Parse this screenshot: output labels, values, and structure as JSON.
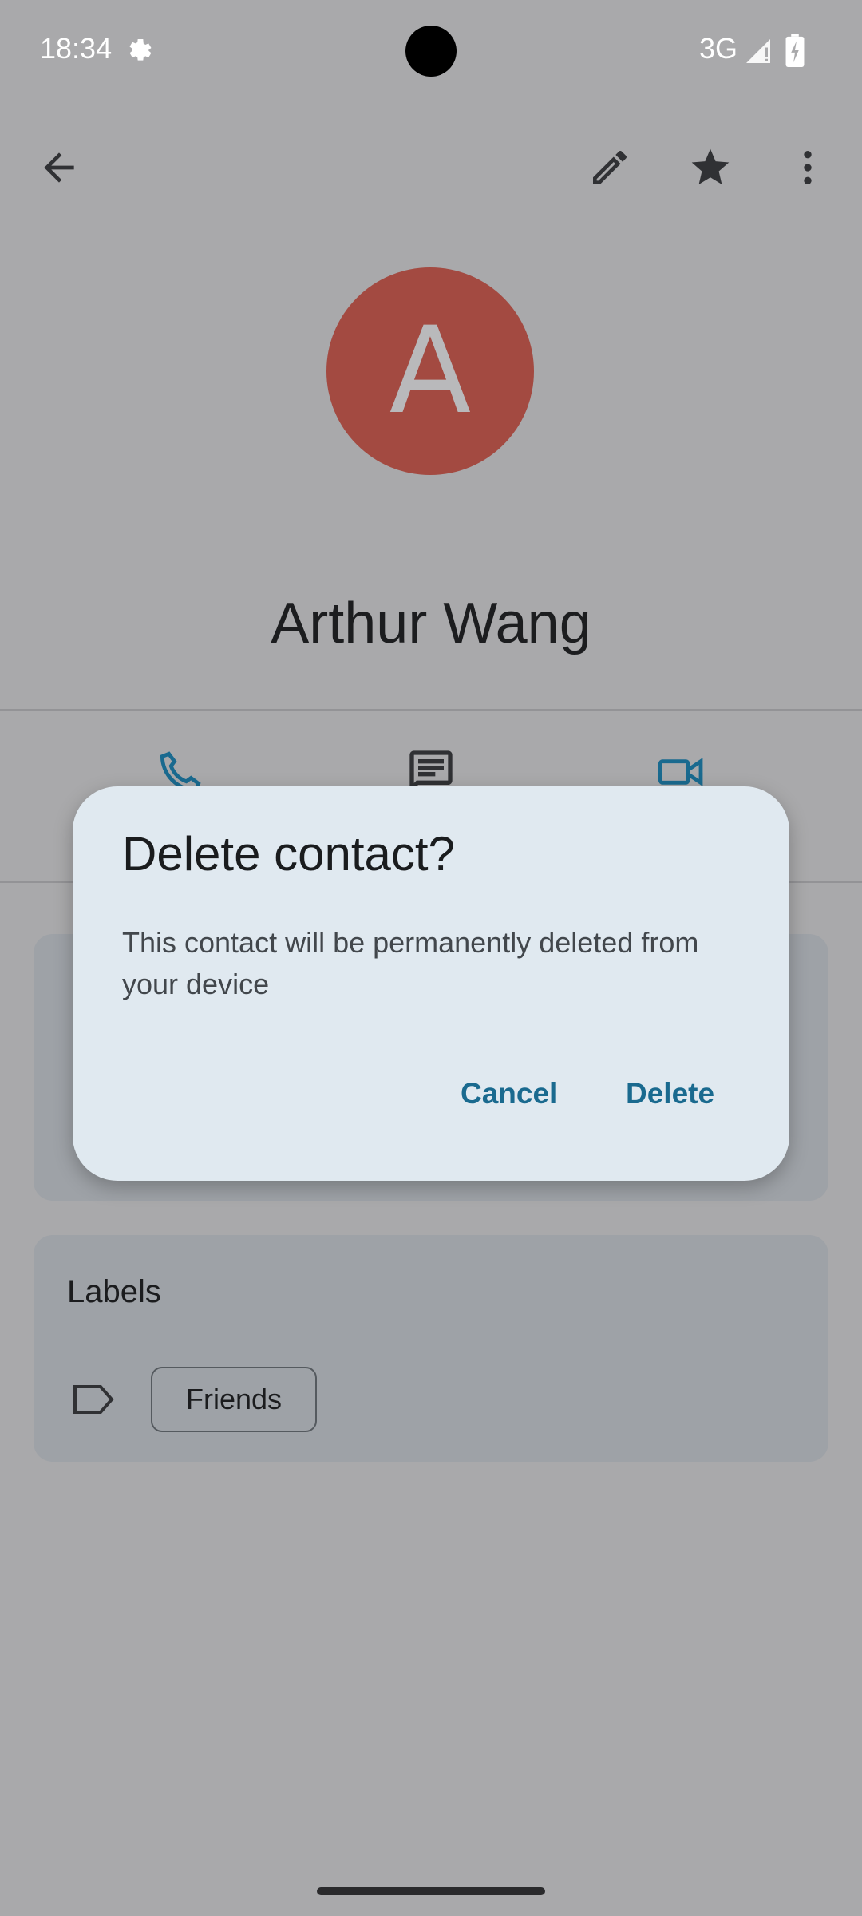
{
  "status_bar": {
    "time": "18:34",
    "network": "3G",
    "icons": [
      "settings-gear-icon",
      "signal-icon",
      "battery-charging-icon"
    ]
  },
  "toolbar": {
    "icons": [
      "back-arrow-icon",
      "edit-pencil-icon",
      "star-icon",
      "more-vert-icon"
    ]
  },
  "contact": {
    "initial": "A",
    "name": "Arthur Wang",
    "avatar_color": "#a34a41"
  },
  "actions": {
    "icons": [
      "phone-icon",
      "message-icon",
      "video-call-icon"
    ],
    "accent": "#1a6a8f"
  },
  "labels_card": {
    "title": "Labels",
    "chip": "Friends"
  },
  "dialog": {
    "title": "Delete contact?",
    "body": "This contact will be permanently deleted from your device",
    "cancel_label": "Cancel",
    "delete_label": "Delete",
    "button_color": "#1a6a8f"
  }
}
